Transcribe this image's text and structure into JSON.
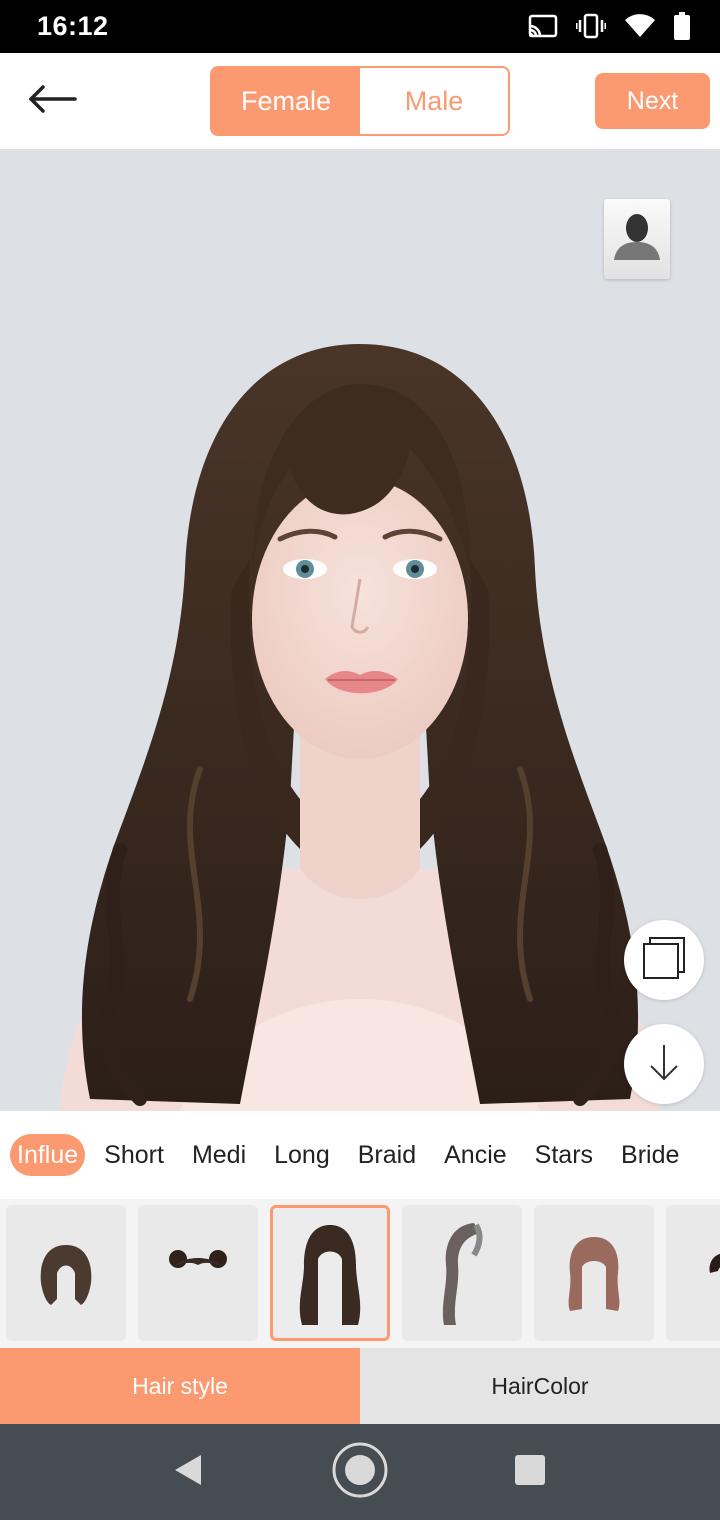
{
  "status_bar": {
    "time": "16:12",
    "icons": [
      "cast-icon",
      "vibrate-icon",
      "wifi-icon",
      "battery-icon"
    ]
  },
  "header": {
    "back_icon": "arrow-left-icon",
    "gender_options": [
      "Female",
      "Male"
    ],
    "selected_gender": "Female",
    "next_label": "Next"
  },
  "photo": {
    "avatar_icon": "person-silhouette-icon",
    "compare_icon": "layers-icon",
    "download_icon": "arrow-down-icon"
  },
  "categories": {
    "items": [
      "Influe",
      "Short",
      "Medi",
      "Long",
      "Braid",
      "Ancie",
      "Stars",
      "Bride"
    ],
    "selected": "Influe"
  },
  "thumbnails": {
    "count_visible": 6,
    "selected_index": 2
  },
  "bottom_tabs": {
    "hair_style": "Hair style",
    "hair_color": "HairColor",
    "selected": "Hair style"
  },
  "nav": {
    "back_icon": "nav-back-icon",
    "home_icon": "nav-home-icon",
    "recents_icon": "nav-recents-icon"
  },
  "colors": {
    "accent": "#fb9a70",
    "photo_background": "#dde1e6",
    "hair": "#3e2b20",
    "nav_bar": "#454c52"
  }
}
